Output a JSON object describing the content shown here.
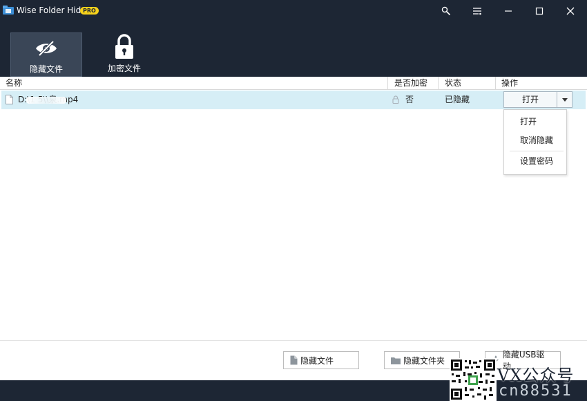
{
  "window": {
    "title": "Wise Folder Hider",
    "badge": "PRO",
    "controls": [
      "tools-icon",
      "menu-icon",
      "minimize-icon",
      "maximize-icon",
      "close-icon"
    ]
  },
  "toolbar": {
    "hide_file": "隐藏文件",
    "encrypt_file": "加密文件"
  },
  "table": {
    "headers": {
      "name": "名称",
      "encrypted": "是否加密",
      "status": "状态",
      "action": "操作"
    },
    "rows": [
      {
        "name": "D:\\1  5\\\\泉.mp4",
        "encrypted": "否",
        "status": "已隐藏",
        "action": "打开"
      }
    ]
  },
  "dropdown_menu": {
    "items": [
      "打开",
      "取消隐藏",
      "设置密码"
    ]
  },
  "bottom_buttons": {
    "hide_file": "隐藏文件",
    "hide_folder": "隐藏文件夹",
    "hide_usb": "隐藏USB驱动..."
  },
  "watermark": {
    "line1": "VX公众号",
    "line2": "cn88531"
  },
  "colors": {
    "chrome": "#1d2634",
    "row_highlight": "#d6eef6",
    "badge": "#f7d21b"
  }
}
